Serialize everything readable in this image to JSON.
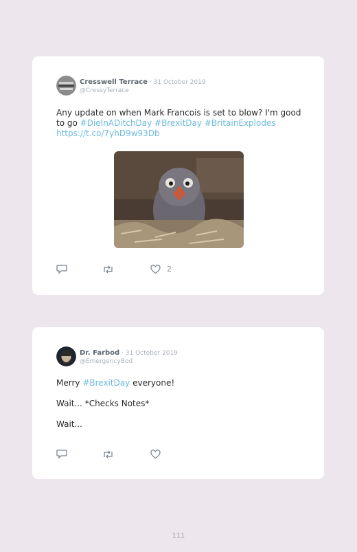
{
  "tweets": [
    {
      "name": "Cresswell Terrace",
      "date": " · 31 October 2019",
      "handle": "@CressyTerrace",
      "text_line1": "Any update on when Mark Francois is set to blow? I'm good",
      "text_line2_pre": "to go ",
      "hashtags": [
        "#DieInADitchDay",
        "#BrexitDay",
        "#BritainExplodes"
      ],
      "url": "https://t.co/7yhD9w93Db",
      "likes": "2"
    },
    {
      "name": "Dr. Farbod",
      "date": " · 31 October 2019",
      "handle": "@EmergencyBod",
      "p1_pre": "Merry ",
      "p1_tag": "#BrexitDay",
      "p1_post": " everyone!",
      "p2": "Wait... *Checks Notes*",
      "p3": "Wait..."
    }
  ],
  "page_number": "111",
  "colors": {
    "background": "#ede7ed",
    "link": "#6bbbe0",
    "card": "#ffffff"
  },
  "icons": [
    "reply-icon",
    "retweet-icon",
    "heart-icon"
  ]
}
